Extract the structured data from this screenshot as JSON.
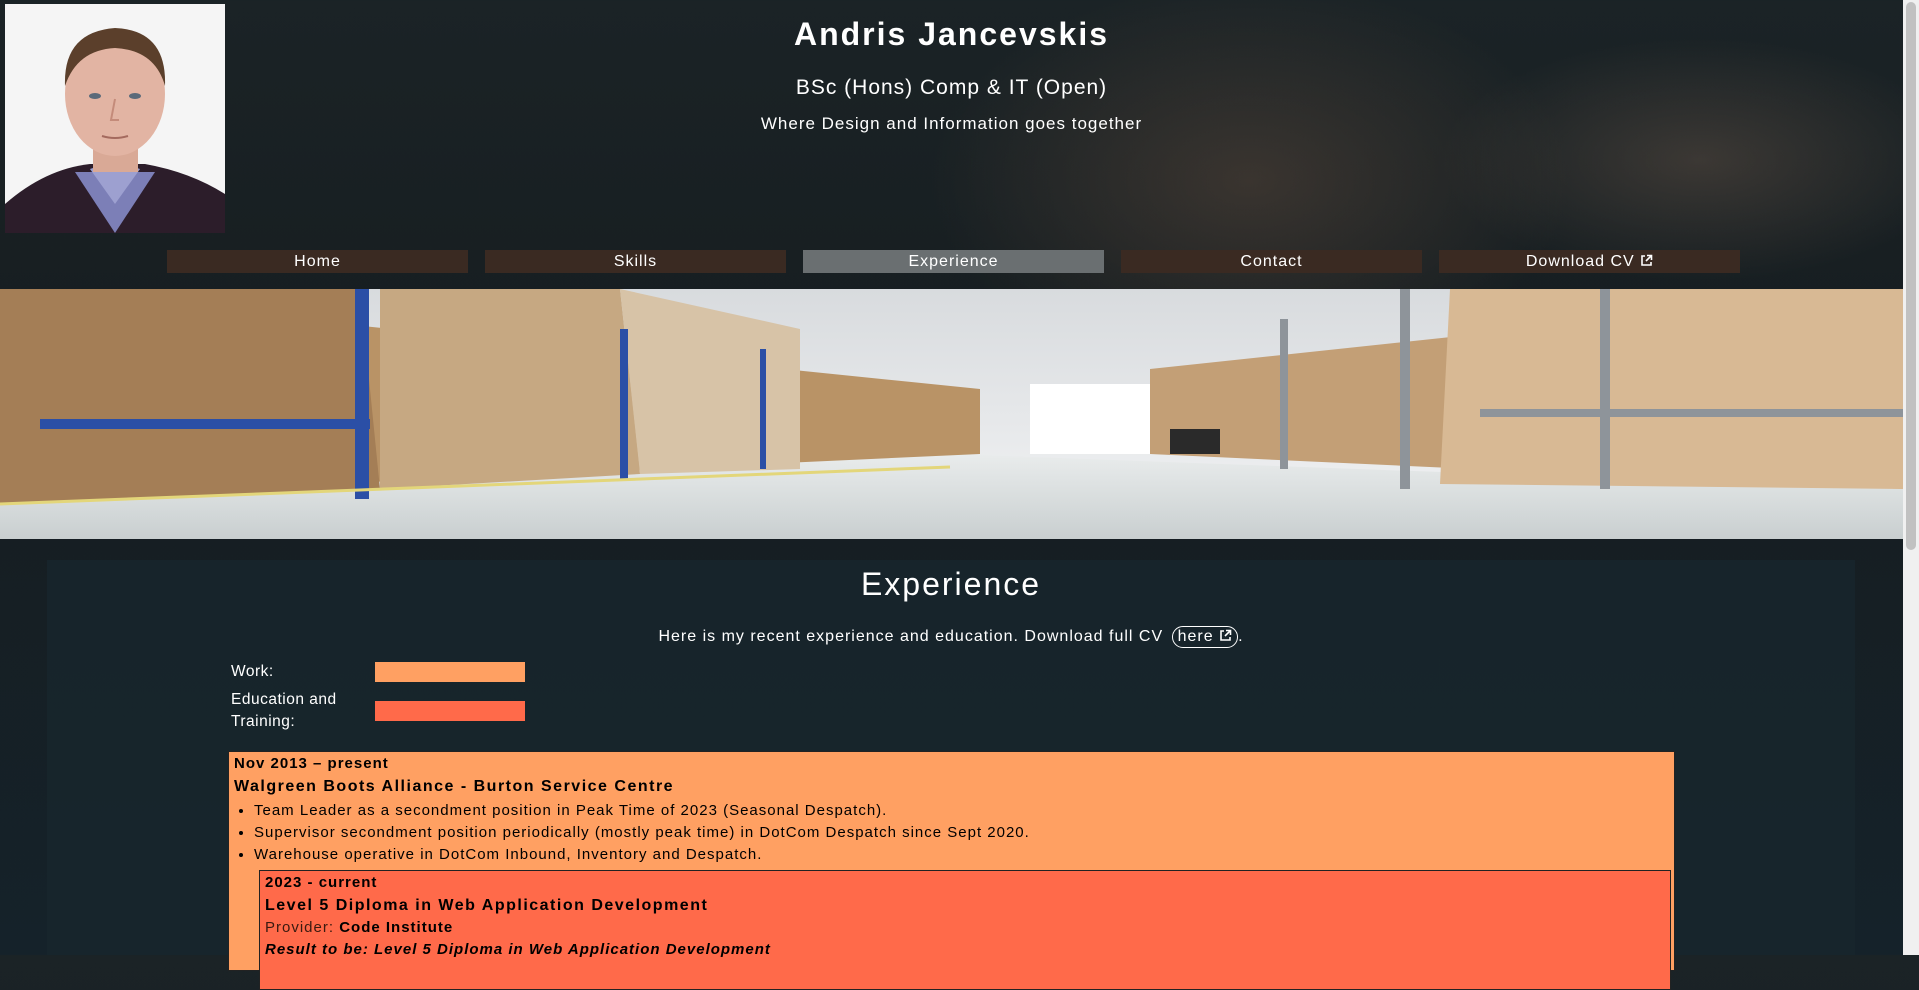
{
  "header": {
    "name": "Andris Jancevskis",
    "degree": "BSc (Hons) Comp & IT (Open)",
    "tagline": "Where Design and Information goes together"
  },
  "nav": {
    "items": [
      {
        "label": "Home",
        "active": false
      },
      {
        "label": "Skills",
        "active": false
      },
      {
        "label": "Experience",
        "active": true
      },
      {
        "label": "Contact",
        "active": false
      },
      {
        "label": "Download CV",
        "active": false,
        "icon": "external-link-icon"
      }
    ]
  },
  "main": {
    "title": "Experience",
    "intro_text": "Here is my recent experience and education. Download full CV",
    "intro_link": "here",
    "intro_end": ".",
    "legend": {
      "work_label": "Work:",
      "education_label": "Education and Training:"
    },
    "work": {
      "date": "Nov 2013 – present",
      "title": "Walgreen Boots Alliance - Burton Service Centre",
      "duties": [
        "Team Leader as a secondment position in Peak Time of 2023 (Seasonal Despatch).",
        "Supervisor secondment position periodically (mostly peak time) in DotCom Despatch since Sept 2020.",
        "Warehouse operative in DotCom Inbound, Inventory and Despatch."
      ]
    },
    "education": {
      "date": "2023 - current",
      "title": "Level 5 Diploma in Web Application Development",
      "provider_label": "Provider:",
      "provider": "Code Institute",
      "result": "Result to be: Level 5 Diploma in Web Application Development"
    }
  },
  "colors": {
    "work": "#ffa062",
    "education": "#ff6a4a",
    "nav_bg": "#3a2a22",
    "nav_active": "#6a6f71"
  }
}
